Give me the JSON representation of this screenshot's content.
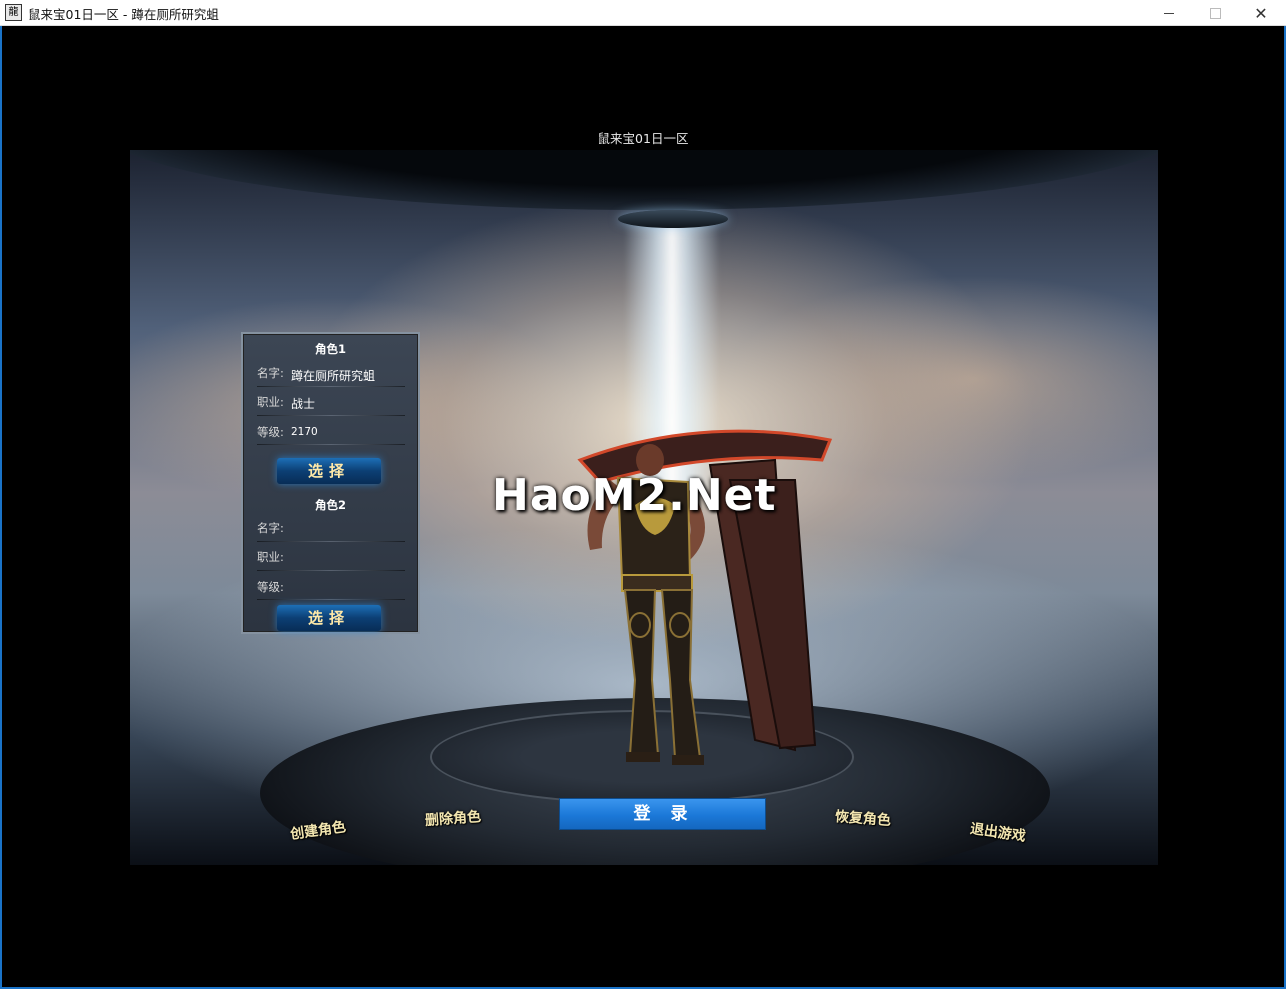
{
  "window": {
    "app_icon_text": "龍",
    "title": "鼠来宝01日一区 - 蹲在厕所研究蛆",
    "min_icon": "minimize-icon",
    "max_icon": "maximize-icon",
    "close_glyph": "✕"
  },
  "server_name": "鼠来宝01日一区",
  "watermark": "HaoM2.Net",
  "slots": [
    {
      "title": "角色1",
      "name_label": "名字:",
      "name": "蹲在厕所研究蛆",
      "job_label": "职业:",
      "job": "战士",
      "level_label": "等级:",
      "level": "2170",
      "select_label": "选择"
    },
    {
      "title": "角色2",
      "name_label": "名字:",
      "name": "",
      "job_label": "职业:",
      "job": "",
      "level_label": "等级:",
      "level": "",
      "select_label": "选择"
    }
  ],
  "actions": {
    "create": "创建角色",
    "delete": "删除角色",
    "login": "登录",
    "restore": "恢复角色",
    "exit": "退出游戏"
  },
  "colors": {
    "frame": "#1a73c8",
    "login_button": "#1b78d8",
    "select_button": "#0c3f74",
    "button_text_gold": "#f3e6b0"
  }
}
